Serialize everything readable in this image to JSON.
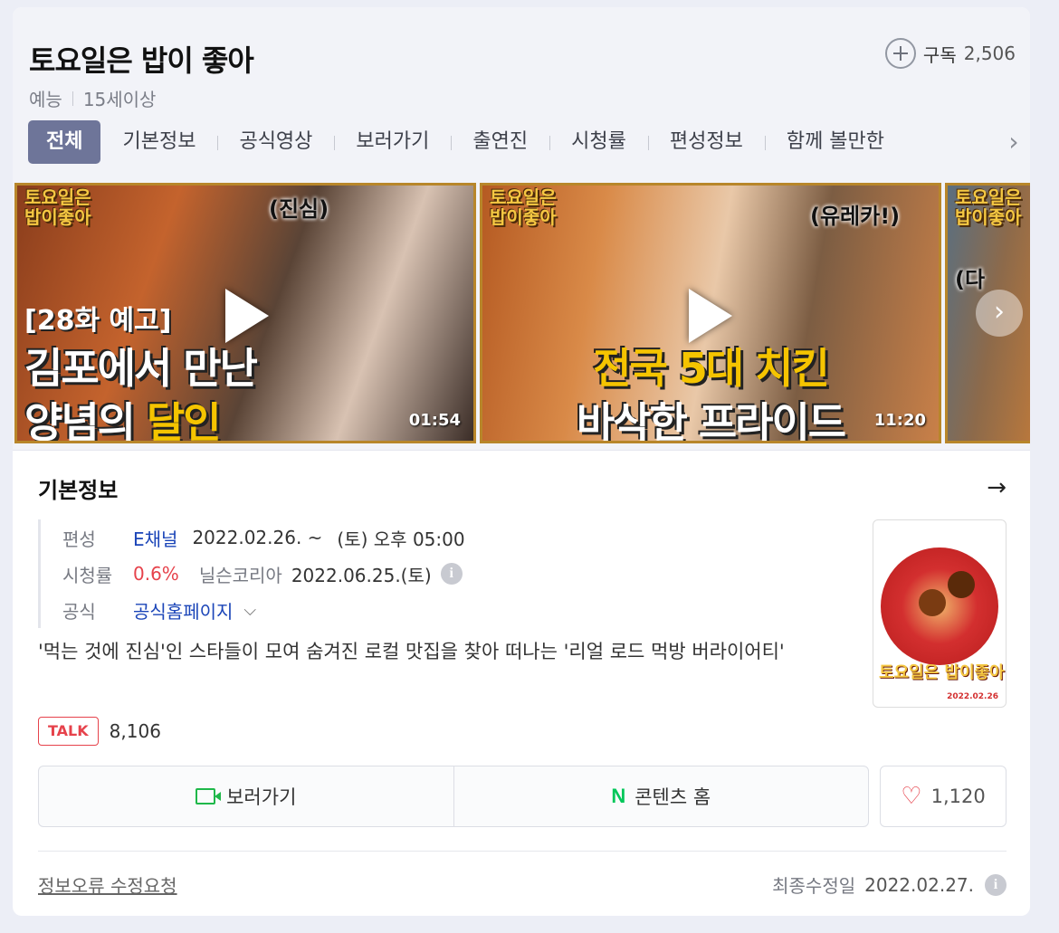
{
  "program": {
    "title": "토요일은 밥이 좋아",
    "genre": "예능",
    "rating": "15세이상",
    "subscribe_label": "구독",
    "subscribe_count": "2,506"
  },
  "tabs": [
    "전체",
    "기본정보",
    "공식영상",
    "보러가기",
    "출연진",
    "시청률",
    "편성정보",
    "함께 볼만한 "
  ],
  "videos": [
    {
      "brand": "토요일은 밥이좋아",
      "bubble": "(진심)",
      "tag": "[28화 예고]",
      "caption_line1": "김포에서 만난",
      "caption_line2a": "양념의 ",
      "caption_line2b": "달인",
      "duration": "01:54"
    },
    {
      "brand": "토요일은 밥이좋아",
      "bubble": "(유레카!)",
      "caption_line1": "전국 5대 치킨",
      "caption_line2": "바삭한 프라이드",
      "duration": "11:20"
    },
    {
      "brand": "토요일은 밥이좋아",
      "bubble": "(다"
    }
  ],
  "basic_info": {
    "section_title": "기본정보",
    "schedule_label": "편성",
    "channel": "E채널",
    "start_date": "2022.02.26. ~",
    "airtime": "(토) 오후 05:00",
    "ratings_label": "시청률",
    "ratings_value": "0.6%",
    "ratings_source": "닐슨코리아",
    "ratings_date": "2022.06.25.(토)",
    "official_label": "공식",
    "official_link": "공식홈페이지",
    "description": "'먹는 것에 진심'인 스타들이 모여 숨겨진 로컬 맛집을 찾아 떠나는 '리얼 로드 먹방 버라이어티'",
    "poster_title": "토요일은 밥이좋아",
    "poster_date": "2022.02.26"
  },
  "talk": {
    "badge": "TALK",
    "count": "8,106"
  },
  "actions": {
    "watch_label": "보러가기",
    "content_home_label": "콘텐츠 홈",
    "like_count": "1,120"
  },
  "footer": {
    "report_label": "정보오류 수정요청",
    "modified_label": "최종수정일",
    "modified_date": "2022.02.27."
  },
  "colors": {
    "accent_tab": "#6e7599",
    "channel_link": "#1b45b8",
    "rating_red": "#e6424b",
    "naver_green": "#03c75a"
  }
}
